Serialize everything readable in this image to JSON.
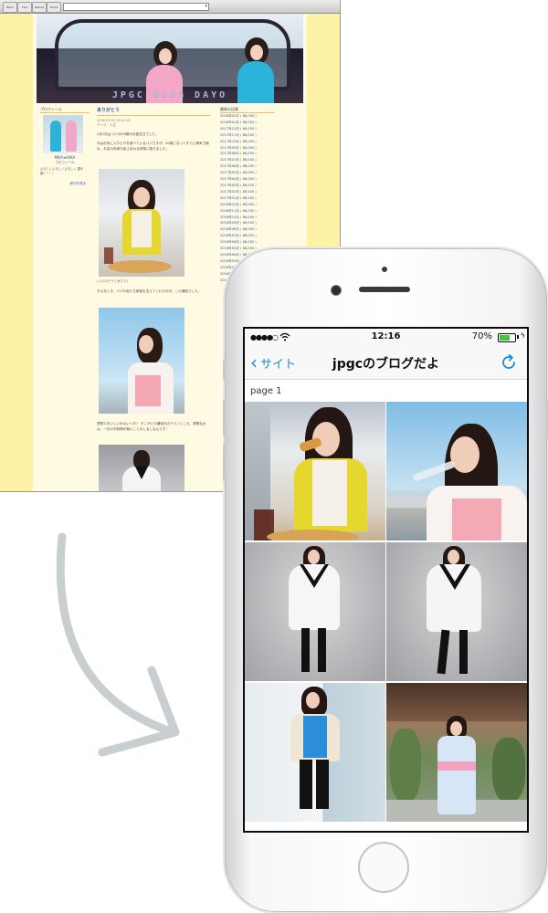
{
  "browser": {
    "toolbar_buttons": [
      "Back",
      "Fwd",
      "Reload",
      "Home"
    ],
    "banner_title": "JPGC BLOG DAYO",
    "profile": {
      "heading": "プロフィール",
      "name": "MIKA★RIKA",
      "link": "プロフィール",
      "text": "よろしくよろしくよろしく 僕の顔！！！！",
      "more": "続きを見る"
    },
    "post": {
      "title": "ありがとう",
      "date": "2016-02-02 22:22:22",
      "theme": "テーマ：人生",
      "para1": "2月1日は パパの58歳のお誕生日でした。",
      "para2": "今はお気に入りピザを食べているパパですが、50歳になってすぐに病気で倒れ、お店の存続も危ぶまれる状態に陥りました。",
      "caption1": "(パパのピザと私たち)",
      "para3": "そんなとき、パパや私たち家族を支えてくれたのが、この通信でした。",
      "para4": "透明でおいしい水ないっす？ そこがとの通信社のテクノところ。透明な水は、一日の不純物が無いことのしるしなんです！"
    },
    "archive": {
      "heading": "最新の記事",
      "items": [
        "2018年02月 ( 88,000 )",
        "2018年01月 ( 88,000 )",
        "2017年12月 ( 88,000 )",
        "2017年11月 ( 88,000 )",
        "2017年10月 ( 88,000 )",
        "2017年09月 ( 88,000 )",
        "2017年08月 ( 88,000 )",
        "2017年07月 ( 88,000 )",
        "2017年06月 ( 88,000 )",
        "2017年05月 ( 88,000 )",
        "2017年04月 ( 88,000 )",
        "2017年03月 ( 88,000 )",
        "2017年02月 ( 88,000 )",
        "2017年01月 ( 88,000 )",
        "2016年12月 ( 88,000 )",
        "2016年11月 ( 88,000 )",
        "2016年10月 ( 88,000 )",
        "2016年09月 ( 88,000 )",
        "2016年08月 ( 88,000 )",
        "2016年07月 ( 88,000 )",
        "2016年06月 ( 88,000 )",
        "2016年05月 ( 88,000 )",
        "2016年04月 ( 88,000 )",
        "2016年03月 ( 88,000 )",
        "2016年02月 ( 88,000 )",
        "2016年01月 ( 88,000 )",
        "2015年12月 ( 88,000 )"
      ]
    }
  },
  "phone": {
    "status": {
      "signal": "●●●●○",
      "time": "12:16",
      "battery_percent": "70%",
      "battery_level": 0.7
    },
    "nav": {
      "back_label": "サイト",
      "title": "jpgcのブログだよ"
    },
    "page_label": "page 1",
    "thumbnails": [
      {
        "subject": "woman-eating-pizza"
      },
      {
        "subject": "woman-drinking-water"
      },
      {
        "subject": "woman-white-sweater-front"
      },
      {
        "subject": "woman-white-sweater-side"
      },
      {
        "subject": "woman-cardigan-blue-top"
      },
      {
        "subject": "woman-in-yukata"
      }
    ]
  },
  "colors": {
    "page_yellow": "#fdf2a6",
    "ios_blue": "#1a8bd6",
    "arrow_gray": "#c9ced1"
  }
}
